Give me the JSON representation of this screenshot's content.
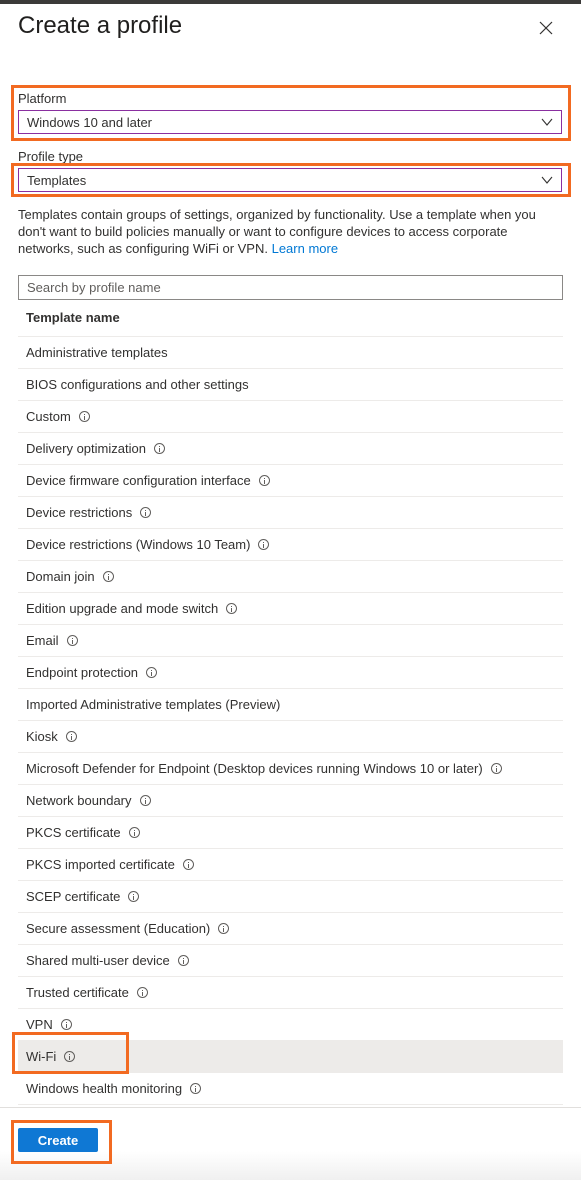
{
  "panel": {
    "title": "Create a profile",
    "close_icon": "close-icon"
  },
  "platform": {
    "label": "Platform",
    "value": "Windows 10 and later"
  },
  "profile_type": {
    "label": "Profile type",
    "value": "Templates"
  },
  "description": {
    "text": "Templates contain groups of settings, organized by functionality. Use a template when you don't want to build policies manually or want to configure devices to access corporate networks, such as configuring WiFi or VPN. ",
    "link": "Learn more"
  },
  "search": {
    "placeholder": "Search by profile name",
    "value": ""
  },
  "table": {
    "header": "Template name",
    "selected": "Wi-Fi",
    "rows": [
      {
        "name": "Administrative templates",
        "info": false
      },
      {
        "name": "BIOS configurations and other settings",
        "info": false
      },
      {
        "name": "Custom",
        "info": true
      },
      {
        "name": "Delivery optimization",
        "info": true
      },
      {
        "name": "Device firmware configuration interface",
        "info": true
      },
      {
        "name": "Device restrictions",
        "info": true
      },
      {
        "name": "Device restrictions (Windows 10 Team)",
        "info": true
      },
      {
        "name": "Domain join",
        "info": true
      },
      {
        "name": "Edition upgrade and mode switch",
        "info": true
      },
      {
        "name": "Email",
        "info": true
      },
      {
        "name": "Endpoint protection",
        "info": true
      },
      {
        "name": "Imported Administrative templates (Preview)",
        "info": false
      },
      {
        "name": "Kiosk",
        "info": true
      },
      {
        "name": "Microsoft Defender for Endpoint (Desktop devices running Windows 10 or later)",
        "info": true
      },
      {
        "name": "Network boundary",
        "info": true
      },
      {
        "name": "PKCS certificate",
        "info": true
      },
      {
        "name": "PKCS imported certificate",
        "info": true
      },
      {
        "name": "SCEP certificate",
        "info": true
      },
      {
        "name": "Secure assessment (Education)",
        "info": true
      },
      {
        "name": "Shared multi-user device",
        "info": true
      },
      {
        "name": "Trusted certificate",
        "info": true
      },
      {
        "name": "VPN",
        "info": true
      },
      {
        "name": "Wi-Fi",
        "info": true
      },
      {
        "name": "Windows health monitoring",
        "info": true
      }
    ]
  },
  "footer": {
    "create_label": "Create"
  },
  "colors": {
    "highlight": "#f26a21",
    "primary": "#0f78d4",
    "link": "#0078d4",
    "select_border": "#8a2fa0"
  }
}
